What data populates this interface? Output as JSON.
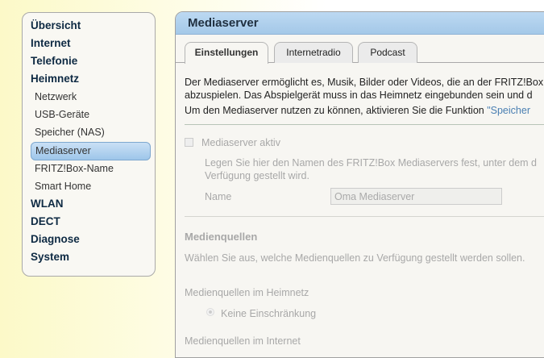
{
  "sidebar": {
    "items": [
      {
        "label": "Übersicht",
        "level": "top"
      },
      {
        "label": "Internet",
        "level": "top"
      },
      {
        "label": "Telefonie",
        "level": "top"
      },
      {
        "label": "Heimnetz",
        "level": "top"
      },
      {
        "label": "Netzwerk",
        "level": "sub"
      },
      {
        "label": "USB-Geräte",
        "level": "sub"
      },
      {
        "label": "Speicher (NAS)",
        "level": "sub"
      },
      {
        "label": "Mediaserver",
        "level": "sub",
        "active": true
      },
      {
        "label": "FRITZ!Box-Name",
        "level": "sub"
      },
      {
        "label": "Smart Home",
        "level": "sub"
      },
      {
        "label": "WLAN",
        "level": "top"
      },
      {
        "label": "DECT",
        "level": "top"
      },
      {
        "label": "Diagnose",
        "level": "top"
      },
      {
        "label": "System",
        "level": "top"
      }
    ]
  },
  "main": {
    "title": "Mediaserver",
    "tabs": [
      "Einstellungen",
      "Internetradio",
      "Podcast"
    ],
    "intro1": "Der Mediaserver ermöglicht es, Musik, Bilder oder Videos, die an der FRITZ!Box",
    "intro2": "abzuspielen. Das Abspielgerät muss in das Heimnetz eingebunden sein und d",
    "intro3": "Um den Mediaserver nutzen zu können, aktivieren Sie die Funktion ",
    "intro3_link": "\"Speicher",
    "active_label": "Mediaserver aktiv",
    "name_hint1": "Legen Sie hier den Namen des FRITZ!Box Mediaservers fest, unter dem d",
    "name_hint2": "Verfügung gestellt wird.",
    "name_label": "Name",
    "name_value": "Oma Mediaserver",
    "sources_title": "Medienquellen",
    "sources_desc": "Wählen Sie aus, welche Medienquellen zu Verfügung gestellt werden sollen.",
    "home_label": "Medienquellen im Heimnetz",
    "home_option": "Keine Einschränkung",
    "internet_label": "Medienquellen im Internet"
  }
}
